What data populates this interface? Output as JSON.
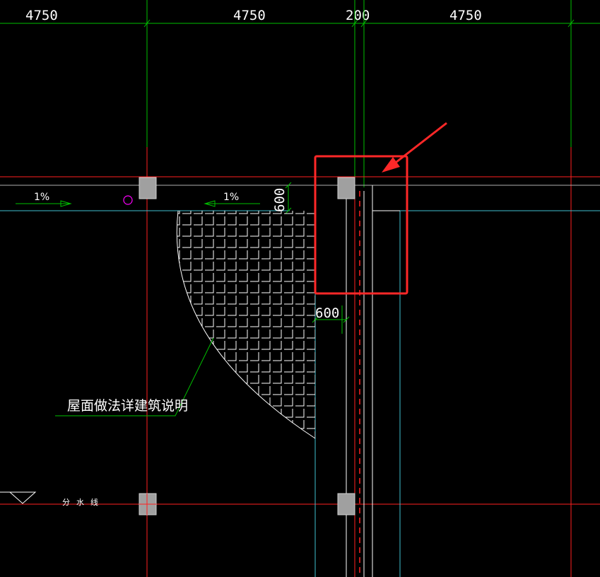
{
  "drawing": {
    "dimensions": {
      "top_left": "4750",
      "top_middle": "4750",
      "top_gap": "200",
      "top_right": "4750",
      "vertical_parapet": "600",
      "horizontal_gutter": "600"
    },
    "slopes": {
      "left": "1%",
      "right": "1%"
    },
    "notes": {
      "roof_note": "屋面做法详建筑说明",
      "divide_line": "分水线"
    },
    "colors": {
      "background": "#000000",
      "axis_green": "#00c000",
      "axis_red": "#ff2020",
      "cyan": "#40c0d0",
      "white": "#ffffff",
      "column_gray": "#a0a0a0",
      "highlight_red": "#ff2828",
      "drain_magenta": "#ff00ff"
    }
  }
}
